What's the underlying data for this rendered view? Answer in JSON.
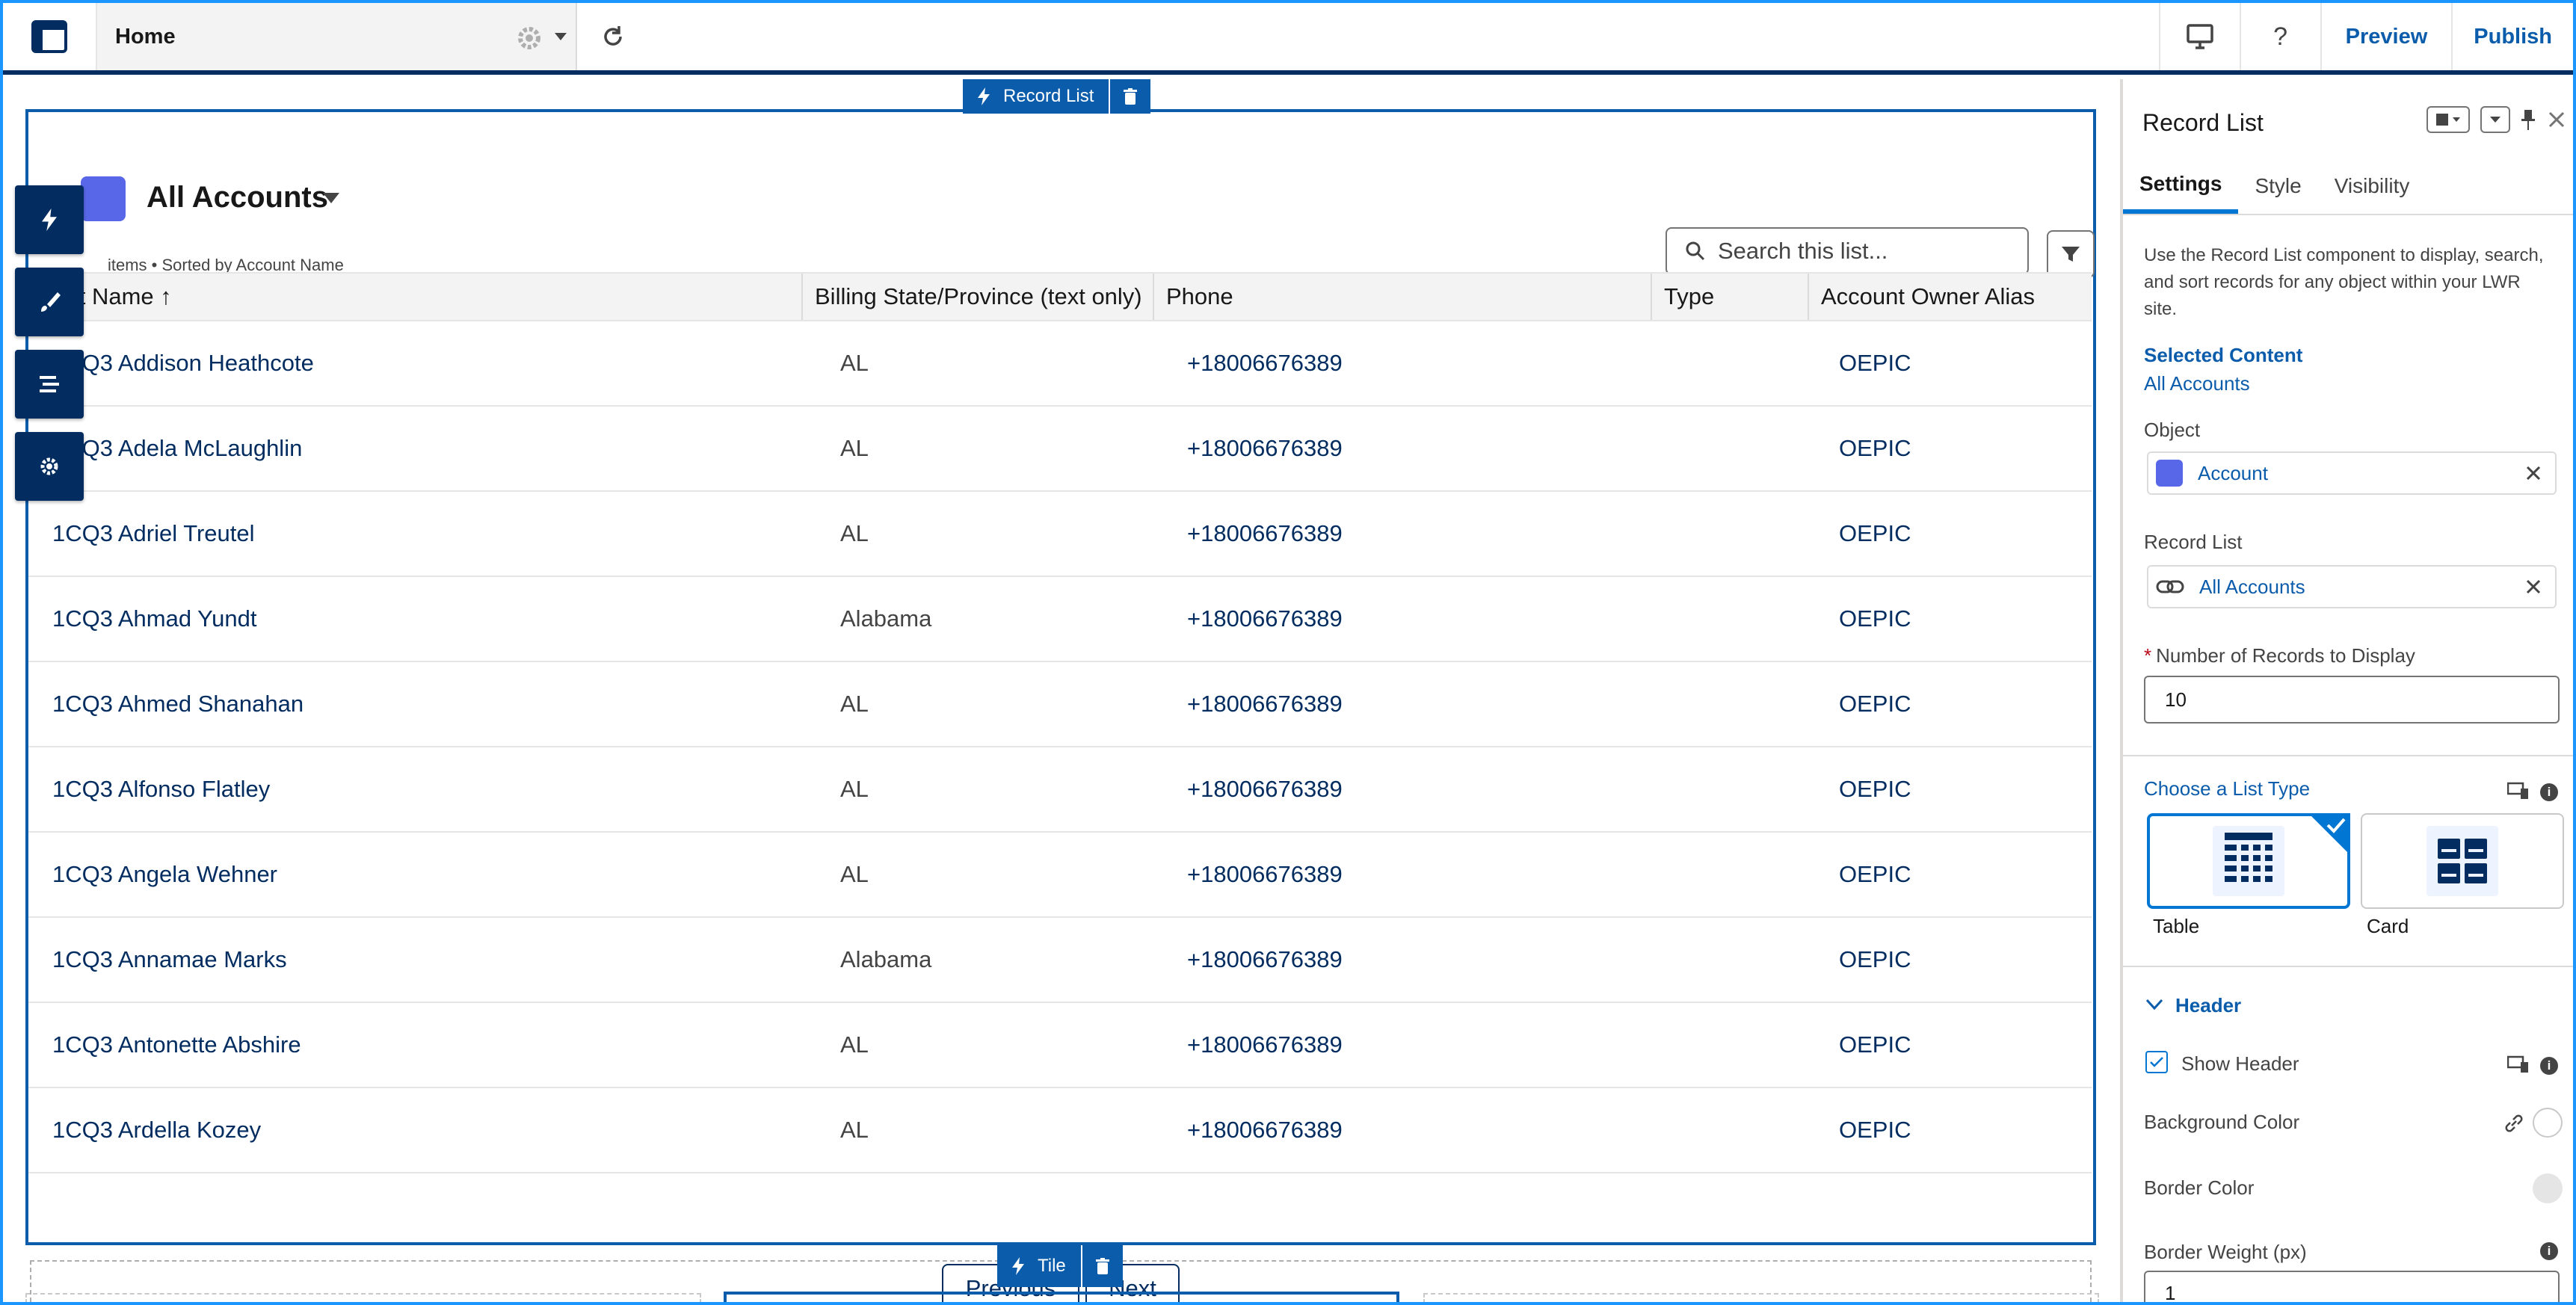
{
  "topbar": {
    "page_name": "Home",
    "preview_label": "Preview",
    "publish_label": "Publish",
    "help_label": "?"
  },
  "component_tag": {
    "label": "Record List"
  },
  "tile_tag": {
    "label": "Tile"
  },
  "list": {
    "title": "All Accounts",
    "subtitle": "items • Sorted by Account Name",
    "search_placeholder": "Search this list...",
    "columns": [
      "ount Name ↑",
      "Billing State/Province (text only)",
      "Phone",
      "Type",
      "Account Owner Alias"
    ],
    "rows": [
      [
        "1CQ3 Addison Heathcote",
        "AL",
        "+18006676389",
        "",
        "OEPIC"
      ],
      [
        "1CQ3 Adela McLaughlin",
        "AL",
        "+18006676389",
        "",
        "OEPIC"
      ],
      [
        "1CQ3 Adriel Treutel",
        "AL",
        "+18006676389",
        "",
        "OEPIC"
      ],
      [
        "1CQ3 Ahmad Yundt",
        "Alabama",
        "+18006676389",
        "",
        "OEPIC"
      ],
      [
        "1CQ3 Ahmed Shanahan",
        "AL",
        "+18006676389",
        "",
        "OEPIC"
      ],
      [
        "1CQ3 Alfonso Flatley",
        "AL",
        "+18006676389",
        "",
        "OEPIC"
      ],
      [
        "1CQ3 Angela Wehner",
        "AL",
        "+18006676389",
        "",
        "OEPIC"
      ],
      [
        "1CQ3 Annamae Marks",
        "Alabama",
        "+18006676389",
        "",
        "OEPIC"
      ],
      [
        "1CQ3 Antonette Abshire",
        "AL",
        "+18006676389",
        "",
        "OEPIC"
      ],
      [
        "1CQ3 Ardella Kozey",
        "AL",
        "+18006676389",
        "",
        "OEPIC"
      ]
    ],
    "previous_label": "Previous",
    "next_label": "Next"
  },
  "panel": {
    "title": "Record List",
    "tabs": [
      "Settings",
      "Style",
      "Visibility"
    ],
    "description": "Use the Record List component to display, search, and sort records for any object within your LWR site.",
    "selected_content_label": "Selected Content",
    "selected_content_value": "All Accounts",
    "object_label": "Object",
    "object_value": "Account",
    "record_list_label": "Record List",
    "record_list_value": "All Accounts",
    "records_to_display_label": "Number of Records to Display",
    "records_to_display_value": "10",
    "list_type_label": "Choose a List Type",
    "list_types": [
      "Table",
      "Card"
    ],
    "header_section": "Header",
    "show_header_label": "Show Header",
    "background_color_label": "Background Color",
    "border_color_label": "Border Color",
    "border_weight_label": "Border Weight (px)",
    "border_weight_value": "1"
  },
  "colors": {
    "brand_dark": "#032d60",
    "brand": "#0b5cab",
    "accent": "#1b96ff",
    "object_icon": "#5867e8"
  }
}
